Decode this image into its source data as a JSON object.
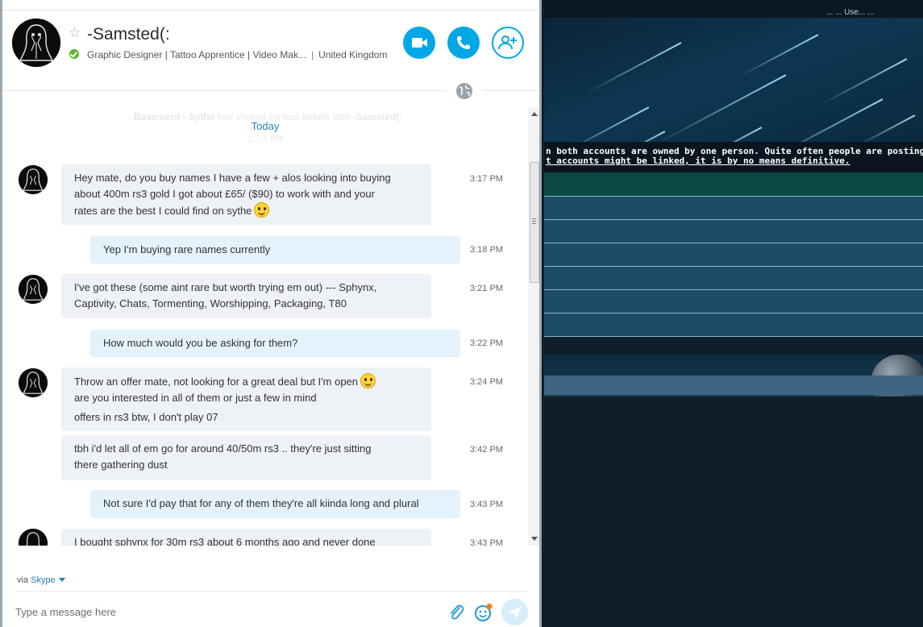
{
  "contact": {
    "name": "-Samsted(:",
    "mood": "Graphic Designer | Tattoo Apprentice | Video Mak...",
    "location": "United Kingdom"
  },
  "chat": {
    "system_note_prefix": "- ",
    "system_note_name": "Basement - Sythe",
    "system_note_text": " has shared contact details with ",
    "system_note_target": "-Samsted(:",
    "day_separator": "Today",
    "system_time": "2:53 PM",
    "messages": [
      {
        "dir": "in",
        "lines": [
          "Hey mate, do you buy names I have a few + alos looking into buying",
          "about 400m rs3 gold I got about £65/ ($90) to work with and your",
          "rates are the best I could find on sythe"
        ],
        "emoji": true,
        "time": "3:17 PM"
      },
      {
        "dir": "out",
        "lines": [
          "Yep I'm buying rare names currently"
        ],
        "time": "3:18 PM"
      },
      {
        "dir": "in",
        "lines": [
          "I've got these (some aint rare but worth trying em out) --- Sphynx,",
          "Captivity, Chats, Tormenting, Worshipping, Packaging, T80"
        ],
        "time": "3:21 PM"
      },
      {
        "dir": "out",
        "lines": [
          "How much would you be asking for them?"
        ],
        "time": "3:22 PM"
      },
      {
        "dir": "in",
        "lines": [
          "Throw an offer mate, not looking for a great deal but I'm open",
          "are you interested in all of them or just a few in mind",
          "offers in rs3 btw, I don't play 07"
        ],
        "emoji": true,
        "time": "3:24 PM"
      },
      {
        "dir": "in",
        "lines": [
          "tbh i'd let all of em go for around 40/50m rs3 .. they're just sitting",
          "there gathering dust"
        ],
        "time": "3:42 PM"
      },
      {
        "dir": "out",
        "lines": [
          "Not sure I'd pay that for any of them they're all kiinda long and plural"
        ],
        "time": "3:43 PM"
      },
      {
        "dir": "in",
        "lines": [
          "I bought sphynx for 30m rs3 about 6 months ago and never done"
        ],
        "time": "3:43 PM"
      }
    ]
  },
  "compose": {
    "via_label": "via",
    "via_link": "Skype",
    "placeholder": "Type a message here"
  },
  "background_page": {
    "top_text": "... ... Use... ...",
    "notice_line1": "n both accounts are owned by one person. Quite often people are posting from",
    "notice_line2": "t accounts might be linked, it is by no means definitive."
  },
  "icons": {
    "star": "star-icon",
    "presence": "online-check-icon",
    "video": "video-camera-icon",
    "call": "phone-icon",
    "add": "add-person-icon",
    "globe": "globe-icon",
    "attach": "paperclip-icon",
    "emoji": "smiley-icon",
    "send": "send-icon"
  },
  "colors": {
    "accent": "#00a7e7",
    "incoming_bubble": "#eef1f5",
    "outgoing_bubble": "#e3f2fb",
    "link": "#1d7ac4"
  }
}
